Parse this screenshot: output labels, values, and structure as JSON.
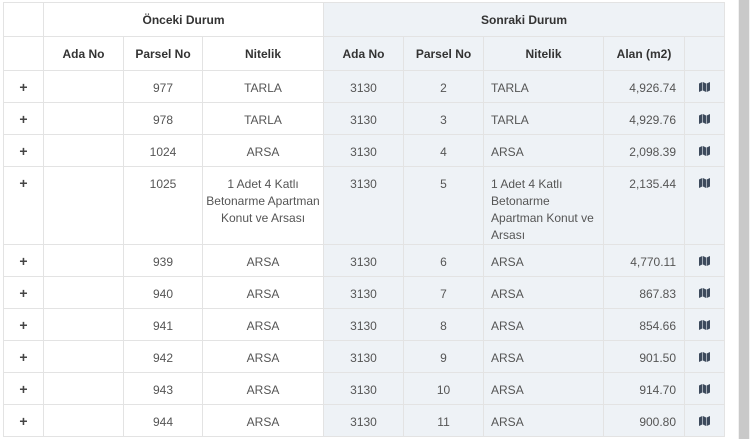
{
  "header": {
    "before_title": "Önceki Durum",
    "after_title": "Sonraki Durum",
    "columns": {
      "ada_no": "Ada No",
      "parsel_no": "Parsel No",
      "nitelik": "Nitelik",
      "alan": "Alan (m2)"
    }
  },
  "expand_glyph": "+",
  "rows": [
    {
      "before_ada": "",
      "before_parsel": "977",
      "before_nitelik": "TARLA",
      "after_ada": "3130",
      "after_parsel": "2",
      "after_nitelik": "TARLA",
      "alan": "4,926.74"
    },
    {
      "before_ada": "",
      "before_parsel": "978",
      "before_nitelik": "TARLA",
      "after_ada": "3130",
      "after_parsel": "3",
      "after_nitelik": "TARLA",
      "alan": "4,929.76"
    },
    {
      "before_ada": "",
      "before_parsel": "1024",
      "before_nitelik": "ARSA",
      "after_ada": "3130",
      "after_parsel": "4",
      "after_nitelik": "ARSA",
      "alan": "2,098.39"
    },
    {
      "before_ada": "",
      "before_parsel": "1025",
      "before_nitelik": "1 Adet 4 Katlı Betonarme Apartman Konut ve Arsası",
      "after_ada": "3130",
      "after_parsel": "5",
      "after_nitelik": "1 Adet 4 Katlı Betonarme Apartman Konut ve Arsası",
      "alan": "2,135.44"
    },
    {
      "before_ada": "",
      "before_parsel": "939",
      "before_nitelik": "ARSA",
      "after_ada": "3130",
      "after_parsel": "6",
      "after_nitelik": "ARSA",
      "alan": "4,770.11"
    },
    {
      "before_ada": "",
      "before_parsel": "940",
      "before_nitelik": "ARSA",
      "after_ada": "3130",
      "after_parsel": "7",
      "after_nitelik": "ARSA",
      "alan": "867.83"
    },
    {
      "before_ada": "",
      "before_parsel": "941",
      "before_nitelik": "ARSA",
      "after_ada": "3130",
      "after_parsel": "8",
      "after_nitelik": "ARSA",
      "alan": "854.66"
    },
    {
      "before_ada": "",
      "before_parsel": "942",
      "before_nitelik": "ARSA",
      "after_ada": "3130",
      "after_parsel": "9",
      "after_nitelik": "ARSA",
      "alan": "901.50"
    },
    {
      "before_ada": "",
      "before_parsel": "943",
      "before_nitelik": "ARSA",
      "after_ada": "3130",
      "after_parsel": "10",
      "after_nitelik": "ARSA",
      "alan": "914.70"
    },
    {
      "before_ada": "",
      "before_parsel": "944",
      "before_nitelik": "ARSA",
      "after_ada": "3130",
      "after_parsel": "11",
      "after_nitelik": "ARSA",
      "alan": "900.80"
    }
  ],
  "icons": {
    "expand": "plus-icon",
    "map": "map-icon"
  },
  "colors": {
    "after_bg": "#eef2f6",
    "border": "#e3e3e3",
    "text": "#555555",
    "header_text": "#333333",
    "map_icon": "#3d4a5c"
  }
}
